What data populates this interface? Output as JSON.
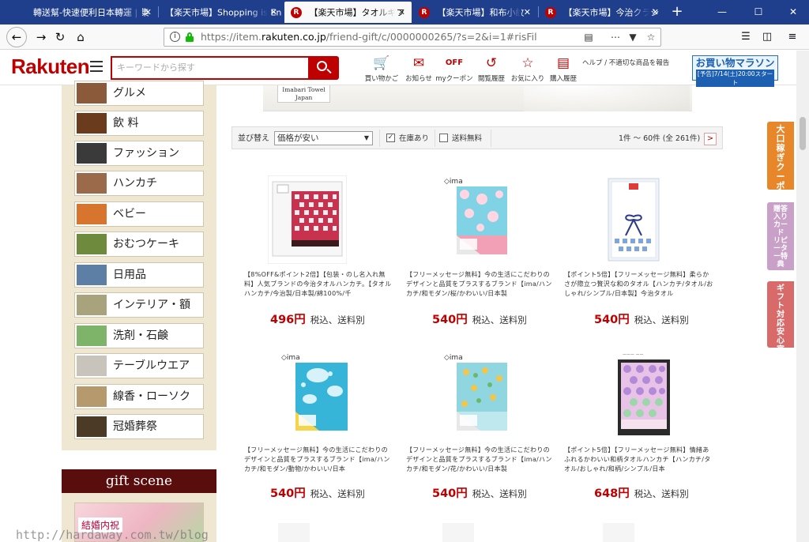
{
  "browser": {
    "tabs": [
      {
        "label": "轉送幫-快速便利日本轉運 | 集",
        "active": false
      },
      {
        "label": "【楽天市場】Shopping is En",
        "active": false
      },
      {
        "label": "【楽天市場】タオルギフ",
        "active": true
      },
      {
        "label": "【楽天市場】和布小紋",
        "active": false
      },
      {
        "label": "【楽天市場】今治クラシ",
        "active": false
      }
    ],
    "tab_close_glyph": "✕",
    "new_tab_glyph": "+",
    "url_prefix": "https://item.",
    "url_domain": "rakuten.co.jp",
    "url_suffix": "/friend-gift/c/0000000265/?s=2&i=1#risFil",
    "window_controls": [
      "—",
      "☐",
      "✕"
    ]
  },
  "header": {
    "logo": "Rakuten",
    "search_placeholder": "キーワードから探す",
    "items": [
      {
        "label": "買い物かご",
        "icon": "cart-icon"
      },
      {
        "label": "お知らせ",
        "icon": "notice-icon"
      },
      {
        "label": "myクーポン",
        "icon": "coupon-icon"
      },
      {
        "label": "閲覧履歴",
        "icon": "history-icon"
      },
      {
        "label": "お気に入り",
        "icon": "star-icon"
      },
      {
        "label": "購入履歴",
        "icon": "purchase-history-icon"
      }
    ],
    "help_link": "ヘルプ / 不適切な商品を報告",
    "marathon_title": "お買い物マラソン",
    "marathon_date": "[予告]7/14(土)20:00スタート"
  },
  "sidebar": {
    "categories": [
      {
        "label": "グルメ",
        "color": "#8a5a3a"
      },
      {
        "label": "飲 料",
        "color": "#6b3b1e"
      },
      {
        "label": "ファッション",
        "color": "#3a3a3a"
      },
      {
        "label": "ハンカチ",
        "color": "#9b6a4a"
      },
      {
        "label": "ベビー",
        "color": "#d7742d"
      },
      {
        "label": "おむつケーキ",
        "color": "#6e8b3d"
      },
      {
        "label": "日用品",
        "color": "#5d7fa6"
      },
      {
        "label": "インテリア・額",
        "color": "#a9a37d"
      },
      {
        "label": "洗剤・石鹸",
        "color": "#7eb36a"
      },
      {
        "label": "テーブルウエア",
        "color": "#c8c4bb"
      },
      {
        "label": "線香・ローソク",
        "color": "#b69a6d"
      },
      {
        "label": "冠婚葬祭",
        "color": "#4b3a25"
      }
    ],
    "gift_scene_title": "gift scene",
    "gift_scene_tag": "結婚内祝"
  },
  "banner": {
    "brand_line1": "Imabari Towel",
    "brand_line2": "Japan"
  },
  "sort": {
    "label": "並び替え",
    "selected": "価格が安い",
    "filter_stock": "在庫あり",
    "filter_stock_checked": true,
    "filter_shipping": "送料無料",
    "filter_shipping_checked": false,
    "count_text": "1件 〜 60件 (全 261件)",
    "next_glyph": ">"
  },
  "products": [
    {
      "desc": "【8%OFF&ポイント2倍】【包装・のし名入れ無料】人気ブランドの今治タオルハンカチ。【タオルハンカチ/今治製/日本製/綿100%/千",
      "price": "496円",
      "note": "税込、送料別",
      "colors": [
        "#c8324f",
        "#ffffff"
      ],
      "logo": ""
    },
    {
      "desc": "【フリーメッセージ無料】今の生活にこだわりのデザインと品質をプラスするブランド【ima/ハンカチ/和モダン/桜/かわいい/日本製",
      "price": "540円",
      "note": "税込、送料別",
      "colors": [
        "#7fd3e4",
        "#f3a3b8"
      ],
      "logo": "◇ima"
    },
    {
      "desc": "【ポイント5倍】【フリーメッセージ無料】柔らかさが際立つ贅沢な和のタオル【ハンカチ/タオル/おしゃれ/シンプル/日本製】今治タオル",
      "price": "540円",
      "note": "税込、送料別",
      "colors": [
        "#e7eef7",
        "#2d3a8c"
      ],
      "logo": ""
    },
    {
      "desc": "【フリーメッセージ無料】今の生活にこだわりのデザインと品質をプラスするブランド【ima/ハンカチ/和モダン/動物/かわいい/日本",
      "price": "540円",
      "note": "税込、送料別",
      "colors": [
        "#36b5d8",
        "#f5d44a"
      ],
      "logo": "◇ima"
    },
    {
      "desc": "【フリーメッセージ無料】今の生活にこだわりのデザインと品質をプラスするブランド【ima/ハンカチ/和モダン/花/かわいい/日本製",
      "price": "540円",
      "note": "税込、送料別",
      "colors": [
        "#8fd6e0",
        "#f2c64a"
      ],
      "logo": "◇ima"
    },
    {
      "desc": "【ポイント5倍】【フリーメッセージ無料】情緒あふれるかわいい和柄タオルハンカチ【ハンカチ/タオル/おしゃれ/和柄/シンプル/日本",
      "price": "648円",
      "note": "税込、送料別",
      "colors": [
        "#d9a3d6",
        "#9dd6a8"
      ],
      "logo": ""
    }
  ],
  "floating_tabs": [
    {
      "label": "大口稼ぎクーポン",
      "color": "#e8862a"
    },
    {
      "label": "贈答入りカード リピーター特典",
      "color": "#c9a0c8"
    },
    {
      "label": "ギフト対応 安心宣言",
      "color": "#d86a6a"
    }
  ],
  "watermark": "http://hardaway.com.tw/blog"
}
